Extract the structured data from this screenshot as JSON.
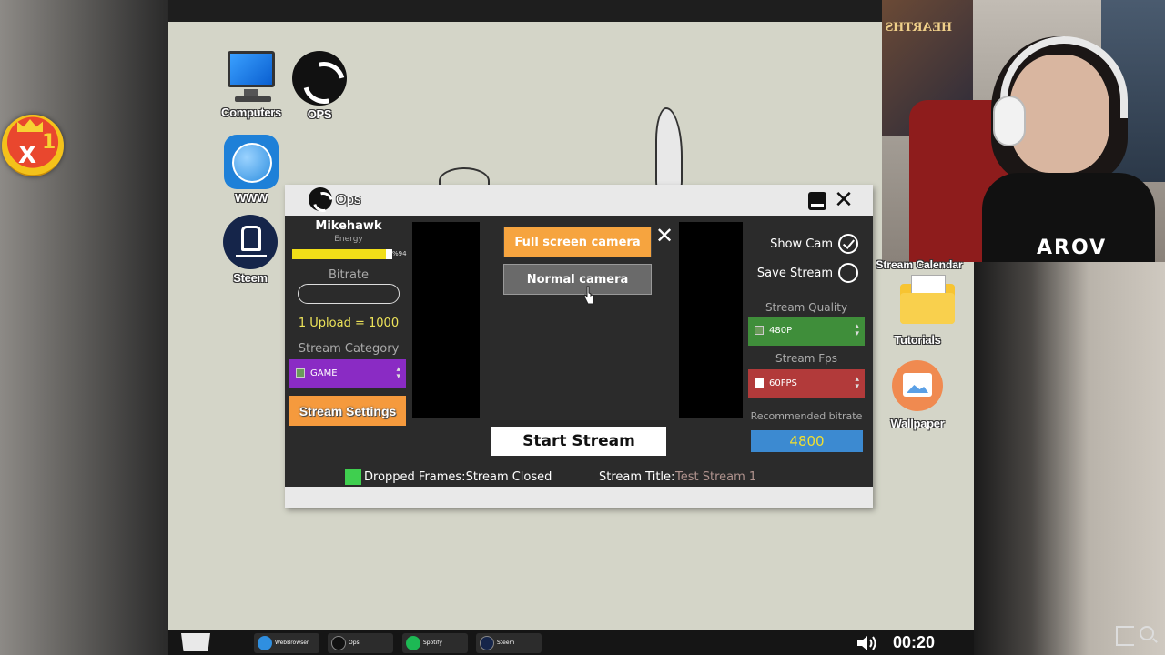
{
  "desktop": {
    "icons_left": [
      {
        "label": "Computers",
        "icon": "computer-icon"
      },
      {
        "label": "OPS",
        "icon": "ops-icon"
      },
      {
        "label": "WWW",
        "icon": "globe-icon"
      },
      {
        "label": "Steem",
        "icon": "steem-icon"
      }
    ],
    "icons_right": [
      {
        "label": "Stream Calendar",
        "icon": "calendar-icon"
      },
      {
        "label": "Tutorials",
        "icon": "folder-icon"
      },
      {
        "label": "Wallpaper",
        "icon": "wallpaper-icon"
      }
    ],
    "badge": {
      "x_label": "X",
      "count": "1"
    }
  },
  "ops_window": {
    "title": "Ops",
    "close_glyph": "✕",
    "user": {
      "name": "Mikehawk",
      "energy_label": "Energy",
      "energy_percent": 94,
      "energy_text": "%94"
    },
    "bitrate_label": "Bitrate",
    "bitrate_value": "",
    "upload_text": "1 Upload = 1000",
    "category_label": "Stream Category",
    "category_value": "GAME",
    "stream_settings_label": "Stream Settings",
    "camera": {
      "full_screen_label": "Full screen camera",
      "normal_label": "Normal camera",
      "close_glyph": "✕"
    },
    "start_stream_label": "Start Stream",
    "show_cam": {
      "label": "Show Cam",
      "checked": true
    },
    "save_stream": {
      "label": "Save Stream",
      "checked": false
    },
    "quality_label": "Stream Quality",
    "quality_value": "480P",
    "fps_label": "Stream Fps",
    "fps_value": "60FPS",
    "recommended_label": "Recommended bitrate",
    "recommended_value": "4800",
    "dropped_frames_text": "Dropped Frames:Stream Closed",
    "stream_title_label": "Stream Title:",
    "stream_title_value": "Test Stream 1"
  },
  "webcam": {
    "poster_text": "HEARTHS",
    "shirt_text": "AROV"
  },
  "taskbar": {
    "items": [
      {
        "label": "WebBrowser",
        "icon": "globe-icon",
        "color": "#2f8fe0"
      },
      {
        "label": "Ops",
        "icon": "ops-icon",
        "color": "#111111"
      },
      {
        "label": "Spotify",
        "icon": "spotify-icon",
        "color": "#1db954"
      },
      {
        "label": "Steem",
        "icon": "steem-icon",
        "color": "#15254a"
      }
    ],
    "clock": "00:20"
  },
  "colors": {
    "orange": "#f59a3d",
    "purple": "#8a2bc4",
    "green": "#3f8e3a",
    "red": "#b23a3a",
    "blue": "#3c8ad1",
    "energy": "#f1de18"
  }
}
